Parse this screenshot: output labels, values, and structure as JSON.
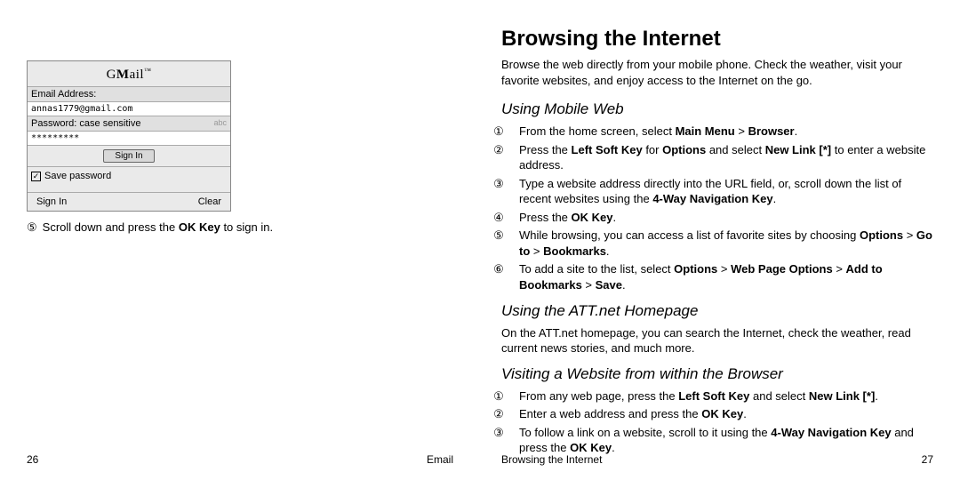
{
  "left": {
    "phone": {
      "brand": "GMail",
      "brand_tm": "™",
      "email_label": "Email Address:",
      "email_value": "annas1779@gmail.com",
      "password_label": "Password:  case sensitive",
      "password_abc": "abc",
      "password_value": "*********",
      "signin_btn": "Sign In",
      "save_label": "Save password",
      "softkey_left": "Sign In",
      "softkey_right": "Clear"
    },
    "caption_num": "⑤",
    "caption_a": "Scroll down and press the ",
    "caption_b": "OK Key",
    "caption_c": " to sign in.",
    "page_num": "26",
    "footer_label": "Email"
  },
  "right": {
    "title": "Browsing the Internet",
    "intro": "Browse the web directly from your mobile phone. Check the weather, visit your favorite websites, and enjoy access to the Internet on the go.",
    "sub1": "Using Mobile Web",
    "s1": {
      "n1": "①",
      "a1": "From the home screen, select ",
      "b1": "Main Menu",
      "c1": " > ",
      "d1": "Browser",
      "e1": ".",
      "n2": "②",
      "a2": "Press the ",
      "b2": "Left Soft Key",
      "c2": " for ",
      "d2": "Options",
      "e2": " and select ",
      "f2": "New Link [*]",
      "g2": " to enter a website address.",
      "n3": "③",
      "a3": "Type a website address directly into the URL field, or, scroll down the list of recent websites using the ",
      "b3": "4-Way Navigation Key",
      "c3": ".",
      "n4": "④",
      "a4": "Press the ",
      "b4": "OK Key",
      "c4": ".",
      "n5": "⑤",
      "a5": "While browsing, you can access a list of favorite sites by choosing ",
      "b5": "Options",
      "c5": " > ",
      "d5": "Go to",
      "e5": " > ",
      "f5": "Bookmarks",
      "g5": ".",
      "n6": "⑥",
      "a6": "To add a site to the list, select ",
      "b6": "Options",
      "c6": " > ",
      "d6": "Web Page Options",
      "e6": " > ",
      "f6": "Add to Bookmarks",
      "g6": " > ",
      "h6": "Save",
      "i6": "."
    },
    "sub2": "Using the ATT.net Homepage",
    "p2": "On the ATT.net homepage, you can search the Internet, check the weather, read current news stories, and much more.",
    "sub3": "Visiting a Website from within the Browser",
    "s3": {
      "n1": "①",
      "a1": "From any web page, press the ",
      "b1": "Left Soft Key",
      "c1": " and select ",
      "d1": "New Link [*]",
      "e1": ".",
      "n2": "②",
      "a2": "Enter a web address and press the ",
      "b2": "OK Key",
      "c2": ".",
      "n3": "③",
      "a3": "To follow a link on a website, scroll to it using the ",
      "b3": "4-Way Navigation Key",
      "c3": " and press the ",
      "d3": "OK Key",
      "e3": "."
    },
    "footer_label": "Browsing the Internet",
    "page_num": "27"
  }
}
